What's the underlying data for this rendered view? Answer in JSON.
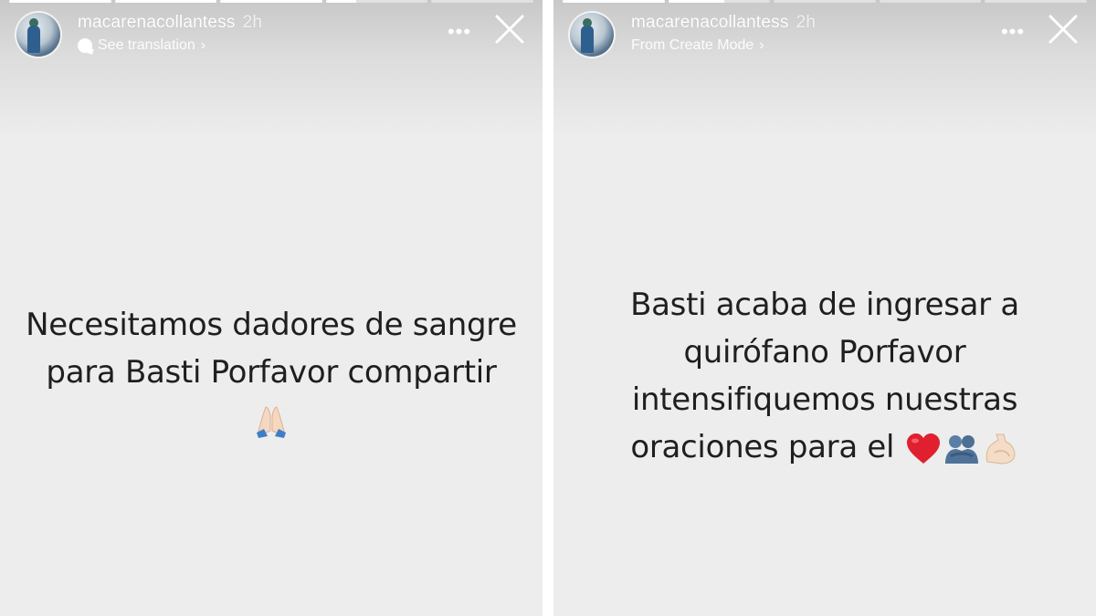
{
  "stories": [
    {
      "username": "macarenacollantess",
      "time": "2h",
      "subline": "See translation",
      "progress": [
        1,
        1,
        1,
        0.3,
        0
      ],
      "text_lines": [
        "Necesitamos dadores de sangre",
        "para Basti Porfavor compartir"
      ],
      "emojis": [
        "praying-hands-icon"
      ]
    },
    {
      "username": "macarenacollantess",
      "time": "2h",
      "subline": "From Create Mode",
      "progress": [
        1,
        0.55,
        0,
        0,
        0
      ],
      "text_lines": [
        "Basti acaba de ingresar a",
        "quirófano Porfavor",
        "intensifiquemos nuestras",
        "oraciones para el"
      ],
      "emojis": [
        "red-heart-icon",
        "people-hugging-icon",
        "flexed-biceps-icon"
      ]
    }
  ],
  "icons": {
    "more": "more-options-icon",
    "close": "close-icon",
    "subline": "speech-bubble-icon",
    "chevron": "chevron-right-icon"
  },
  "colors": {
    "background": "#ededed",
    "text": "#1f1f1f",
    "heart": "#e0202e"
  }
}
